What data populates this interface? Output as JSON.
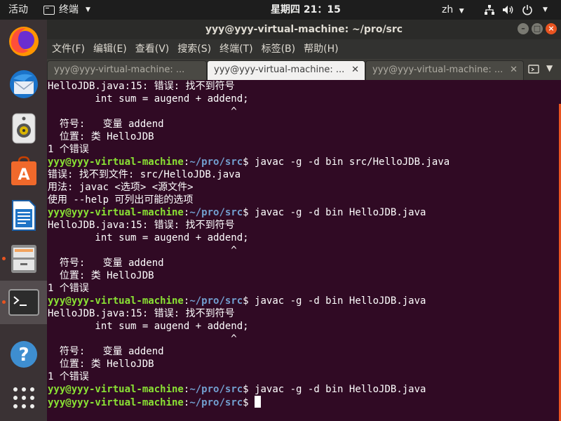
{
  "topbar": {
    "activities": "活动",
    "app_menu": "终端",
    "clock": "星期四 21：15",
    "input_method": "zh"
  },
  "dock": {
    "items": [
      {
        "name": "firefox-icon"
      },
      {
        "name": "thunderbird-icon"
      },
      {
        "name": "rhythmbox-icon"
      },
      {
        "name": "software-center-icon"
      },
      {
        "name": "libreoffice-writer-icon"
      },
      {
        "name": "files-icon"
      },
      {
        "name": "terminal-icon"
      },
      {
        "name": "help-icon"
      },
      {
        "name": "show-apps-icon"
      }
    ]
  },
  "window": {
    "title": "yyy@yyy-virtual-machine: ~/pro/src",
    "menu": [
      "文件(F)",
      "编辑(E)",
      "查看(V)",
      "搜索(S)",
      "终端(T)",
      "标签(B)",
      "帮助(H)"
    ],
    "tabs": [
      {
        "label": "yyy@yyy-virtual-machine: ...",
        "active": false
      },
      {
        "label": "yyy@yyy-virtual-machine: ...",
        "active": true
      },
      {
        "label": "yyy@yyy-virtual-machine: ...",
        "active": false
      }
    ]
  },
  "terminal": {
    "prompt_user": "yyy@yyy-virtual-machine",
    "prompt_colon": ":",
    "prompt_path": "~/pro/src",
    "prompt_dollar": "$ ",
    "lines": [
      {
        "kind": "text",
        "text": "HelloJDB.java:15: 错误: 找不到符号"
      },
      {
        "kind": "text",
        "text": "        int sum = augend + addend;"
      },
      {
        "kind": "text",
        "text": "                               ^"
      },
      {
        "kind": "text",
        "text": "  符号:   变量 addend"
      },
      {
        "kind": "text",
        "text": "  位置: 类 HelloJDB"
      },
      {
        "kind": "text",
        "text": "1 个错误"
      },
      {
        "kind": "cmd",
        "text": "javac -g -d bin src/HelloJDB.java"
      },
      {
        "kind": "text",
        "text": "错误: 找不到文件: src/HelloJDB.java"
      },
      {
        "kind": "text",
        "text": "用法: javac <选项> <源文件>"
      },
      {
        "kind": "text",
        "text": "使用 --help 可列出可能的选项"
      },
      {
        "kind": "cmd",
        "text": "javac -g -d bin HelloJDB.java"
      },
      {
        "kind": "text",
        "text": "HelloJDB.java:15: 错误: 找不到符号"
      },
      {
        "kind": "text",
        "text": "        int sum = augend + addend;"
      },
      {
        "kind": "text",
        "text": "                               ^"
      },
      {
        "kind": "text",
        "text": "  符号:   变量 addend"
      },
      {
        "kind": "text",
        "text": "  位置: 类 HelloJDB"
      },
      {
        "kind": "text",
        "text": "1 个错误"
      },
      {
        "kind": "cmd",
        "text": "javac -g -d bin HelloJDB.java"
      },
      {
        "kind": "text",
        "text": "HelloJDB.java:15: 错误: 找不到符号"
      },
      {
        "kind": "text",
        "text": "        int sum = augend + addend;"
      },
      {
        "kind": "text",
        "text": "                               ^"
      },
      {
        "kind": "text",
        "text": "  符号:   变量 addend"
      },
      {
        "kind": "text",
        "text": "  位置: 类 HelloJDB"
      },
      {
        "kind": "text",
        "text": "1 个错误"
      },
      {
        "kind": "cmd",
        "text": "javac -g -d bin HelloJDB.java"
      },
      {
        "kind": "cmd",
        "text": "",
        "cursor": true
      }
    ]
  },
  "colors": {
    "terminal_bg": "#300a24",
    "prompt_user": "#8ae234",
    "prompt_path": "#729fcf",
    "accent": "#e95420"
  }
}
